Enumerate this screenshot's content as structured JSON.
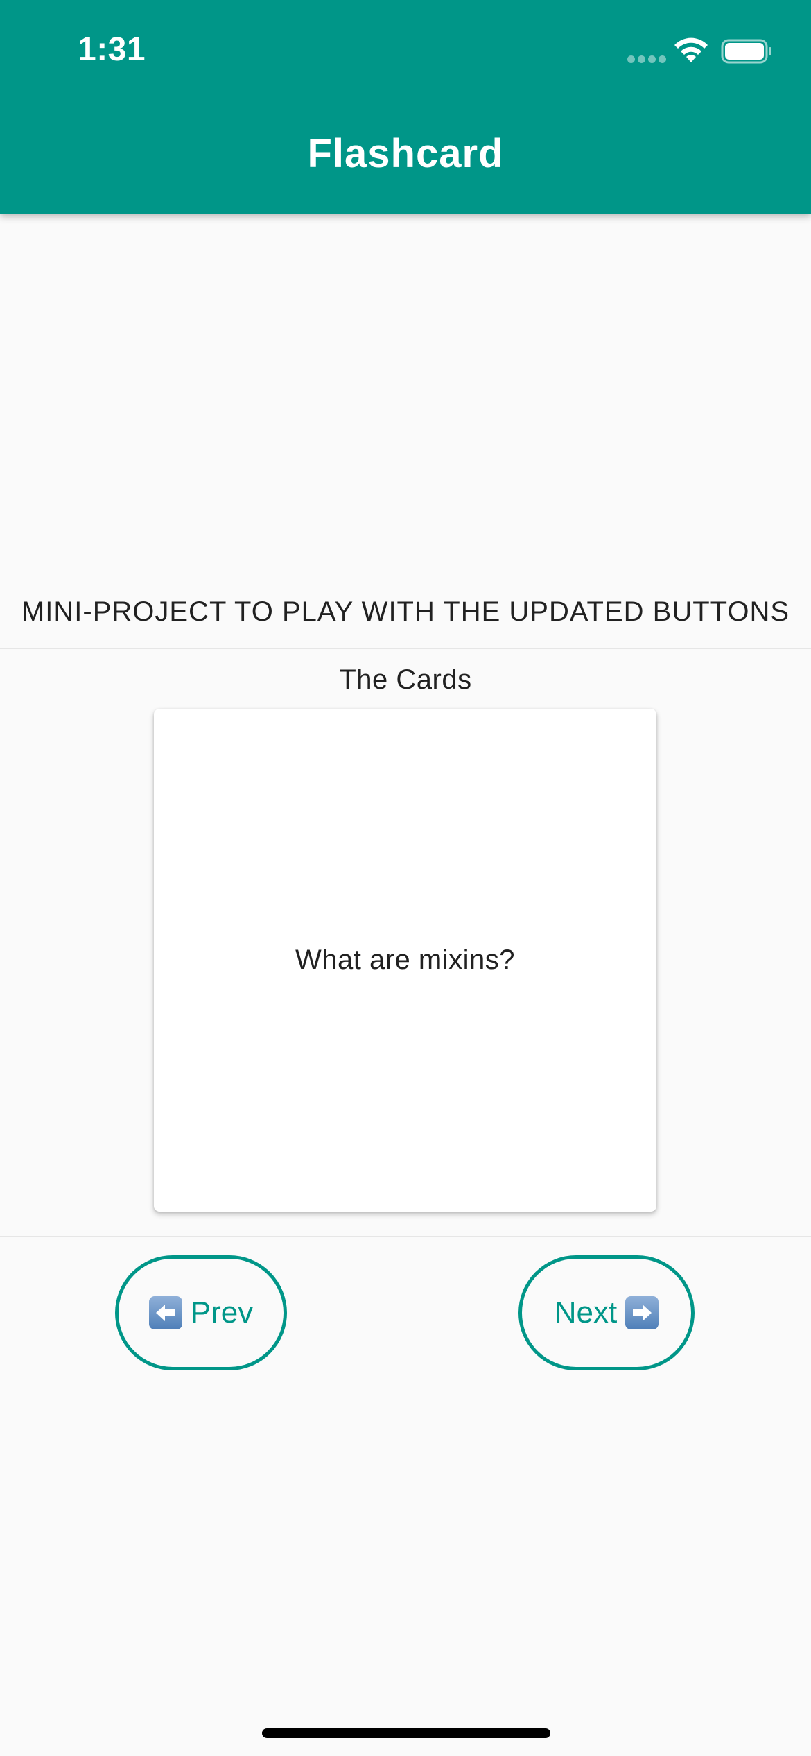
{
  "status_bar": {
    "time": "1:31"
  },
  "app_bar": {
    "title": "Flashcard",
    "color": "#009688"
  },
  "main": {
    "subtitle": "MINI-PROJECT TO PLAY WITH THE UPDATED BUTTONS",
    "section_title": "The Cards",
    "card_question": "What are mixins?"
  },
  "buttons": {
    "prev_label": "Prev",
    "next_label": "Next",
    "prev_icon": "left-arrow-emoji-icon",
    "next_icon": "right-arrow-emoji-icon",
    "accent": "#009688"
  }
}
